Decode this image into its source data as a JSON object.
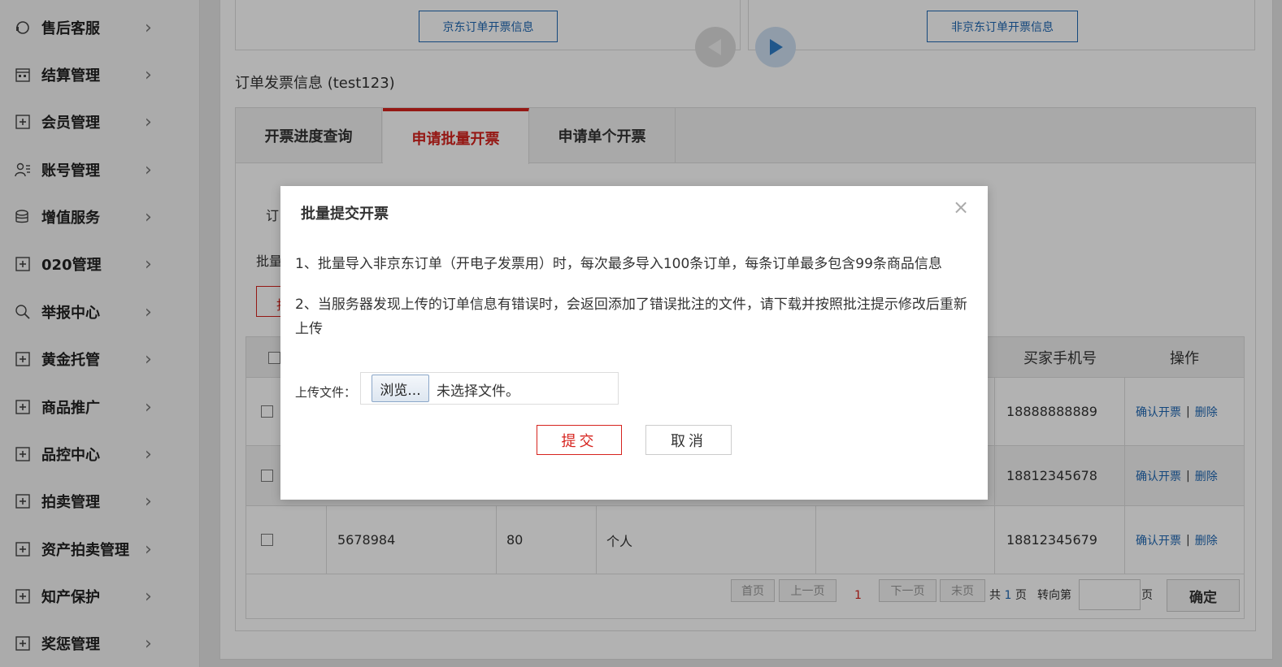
{
  "sidebar": {
    "items": [
      {
        "label": "售后客服",
        "icon": "headset-icon"
      },
      {
        "label": "结算管理",
        "icon": "calendar-icon"
      },
      {
        "label": "会员管理",
        "icon": "plus-square-icon"
      },
      {
        "label": "账号管理",
        "icon": "user-list-icon"
      },
      {
        "label": "增值服务",
        "icon": "coins-icon"
      },
      {
        "label": "020管理",
        "icon": "plus-square-icon"
      },
      {
        "label": "举报中心",
        "icon": "search-report-icon"
      },
      {
        "label": "黄金托管",
        "icon": "plus-square-icon"
      },
      {
        "label": "商品推广",
        "icon": "plus-square-icon"
      },
      {
        "label": "品控中心",
        "icon": "plus-square-icon"
      },
      {
        "label": "拍卖管理",
        "icon": "plus-square-icon"
      },
      {
        "label": "资产拍卖管理",
        "icon": "plus-square-icon"
      },
      {
        "label": "知产保护",
        "icon": "plus-square-icon"
      },
      {
        "label": "奖惩管理",
        "icon": "plus-square-icon"
      }
    ]
  },
  "cards": {
    "jd_button": "京东订单开票信息",
    "non_jd_button": "非京东订单开票信息"
  },
  "section": {
    "title": "订单发票信息 (test123)"
  },
  "tabs": [
    {
      "label": "开票进度查询"
    },
    {
      "label": "申请批量开票"
    },
    {
      "label": "申请单个开票"
    }
  ],
  "background": {
    "label_order": "订",
    "label_batch": "批量",
    "red_btn_char": "批"
  },
  "table": {
    "headers": {
      "buyer_phone": "买家手机号",
      "operation": "操作"
    },
    "rows": [
      {
        "order_no": "",
        "amount": "",
        "type": "",
        "phone": "18888888889",
        "confirm": "确认开票",
        "delete": "删除"
      },
      {
        "order_no": "",
        "amount": "",
        "type": "",
        "phone": "18812345678",
        "confirm": "确认开票",
        "delete": "删除"
      },
      {
        "order_no": "5678984",
        "amount": "80",
        "type": "个人",
        "phone": "18812345679",
        "confirm": "确认开票",
        "delete": "删除"
      }
    ],
    "separator": "|"
  },
  "pager": {
    "first": "首页",
    "prev": "上一页",
    "current": "1",
    "next": "下一页",
    "last": "末页",
    "total_prefix": "共",
    "total_pages": "1",
    "total_suffix": "页",
    "goto_prefix": "转向第",
    "goto_suffix": "页",
    "confirm": "确定"
  },
  "modal": {
    "title": "批量提交开票",
    "close": "×",
    "line1": "1、批量导入非京东订单（开电子发票用）时，每次最多导入100条订单，每条订单最多包含99条商品信息",
    "line2": "2、当服务器发现上传的订单信息有错误时，会返回添加了错误批注的文件，请下载并按照批注提示修改后重新上传",
    "upload_label": "上传文件：",
    "browse": "浏览...",
    "file_status": "未选择文件。",
    "submit": "提交",
    "cancel": "取消"
  },
  "colors": {
    "accent_red": "#d6231e",
    "link_blue": "#1f67b3",
    "arrow_blue": "#2f7dc8"
  }
}
